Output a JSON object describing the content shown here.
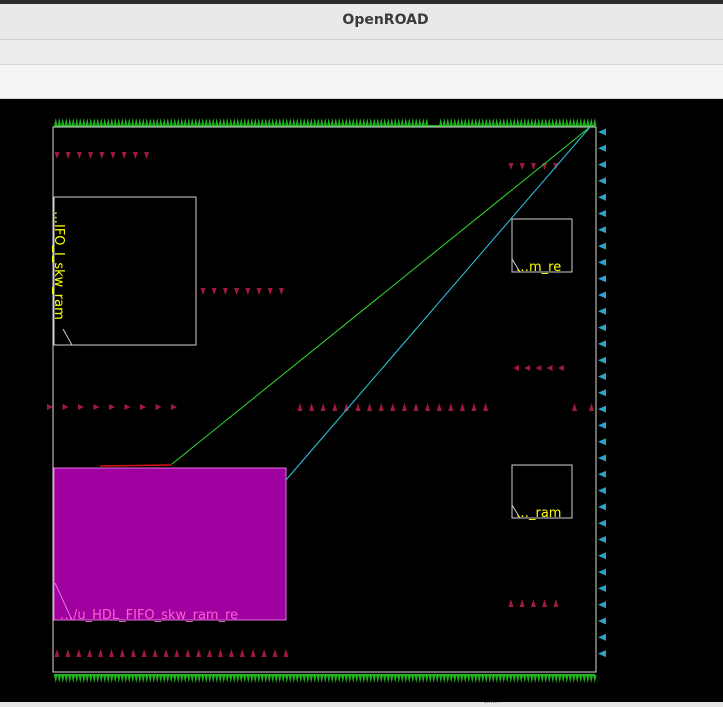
{
  "window": {
    "title": "OpenROAD"
  },
  "layout": {
    "instance_labels": {
      "left_macro": "…IFO_I_skw_ram",
      "right_macro_top": "…m_re",
      "right_macro_bottom": "…_ram",
      "selected_macro": "…/u_HDL_FIFO_skw_ram_re"
    },
    "colors": {
      "background": "#000000",
      "die_outline": "#d9d9d9",
      "macro_outline": "#cfcfcf",
      "selected_fill": "#a000a0",
      "label": "#ffff00",
      "pins_top_bottom": "#1fb31f",
      "pins_right": "#2aa4c8",
      "markers": "#a01a3c",
      "flyline_green": "#2fdc2f",
      "flyline_cyan": "#2ec8e6",
      "flyline_red": "#e01010"
    }
  }
}
